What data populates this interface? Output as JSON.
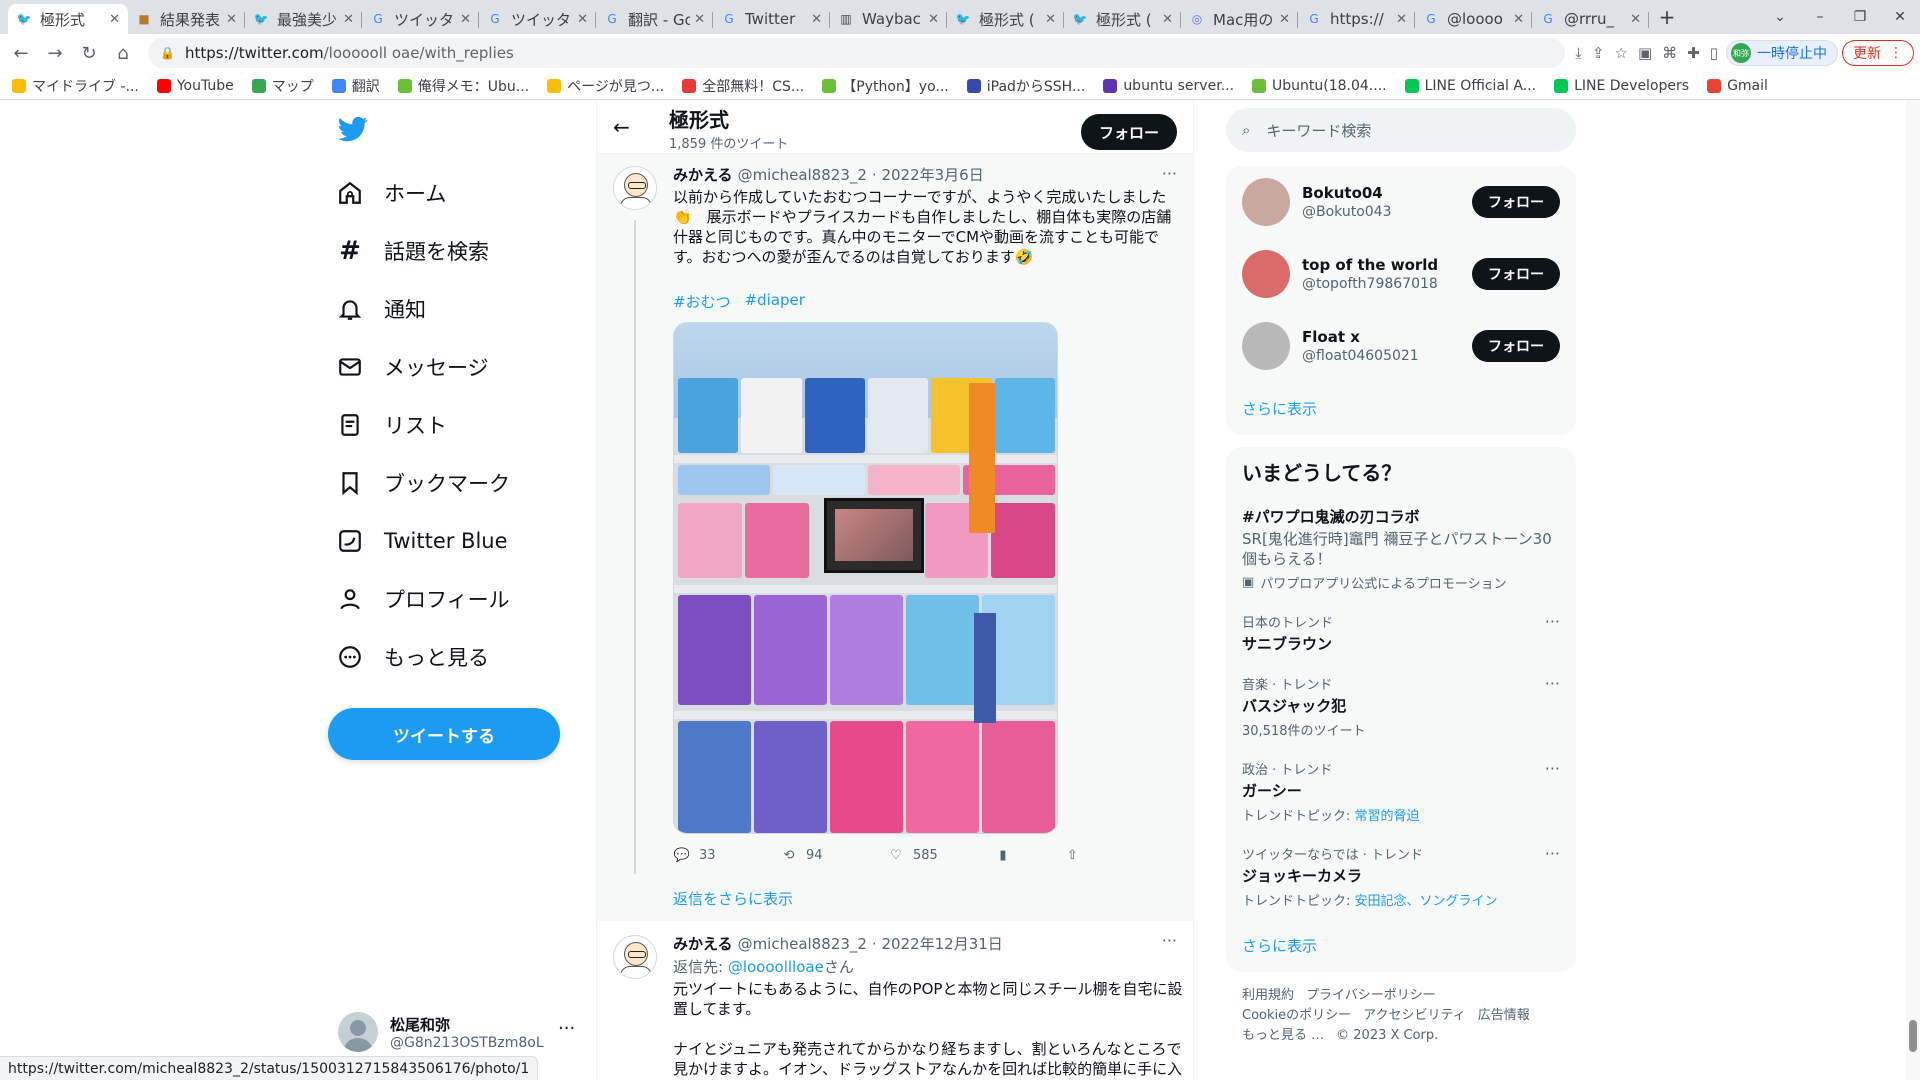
{
  "browser": {
    "tabs": [
      {
        "title": "極形式",
        "icon": "twitter-icon",
        "active": true
      },
      {
        "title": "結果発表",
        "icon": "site-icon"
      },
      {
        "title": "最強美少",
        "icon": "twitter-icon"
      },
      {
        "title": "ツイッタ",
        "icon": "google-icon"
      },
      {
        "title": "ツイッタ",
        "icon": "google-icon"
      },
      {
        "title": "翻訳 - Go",
        "icon": "google-icon"
      },
      {
        "title": "Twitter",
        "icon": "google-icon"
      },
      {
        "title": "Waybac",
        "icon": "archive-icon"
      },
      {
        "title": "極形式 (",
        "icon": "twitter-icon"
      },
      {
        "title": "極形式 (",
        "icon": "twitter-icon"
      },
      {
        "title": "Mac用の",
        "icon": "github-icon"
      },
      {
        "title": "https://",
        "icon": "google-icon"
      },
      {
        "title": "@loooo",
        "icon": "google-icon"
      },
      {
        "title": "@rrru_",
        "icon": "google-icon"
      }
    ],
    "url_host": "https://twitter.com",
    "url_path": "/loooooll oae/with_replies",
    "pause_label": "一時停止中",
    "profile_initials": "和弥",
    "update_label": "更新",
    "bookmarks": [
      {
        "label": "マイドライブ -...",
        "color": "#fbbc04"
      },
      {
        "label": "YouTube",
        "color": "#ff0000"
      },
      {
        "label": "マップ",
        "color": "#34a853"
      },
      {
        "label": "翻訳",
        "color": "#4285f4"
      },
      {
        "label": "俺得メモ：Ubu...",
        "color": "#6abf3b"
      },
      {
        "label": "ページが見つ...",
        "color": "#fbbc04"
      },
      {
        "label": "全部無料！CS...",
        "color": "#e53935"
      },
      {
        "label": "【Python】yo...",
        "color": "#6abf3b"
      },
      {
        "label": "iPadからSSH...",
        "color": "#3949ab"
      },
      {
        "label": "ubuntu server...",
        "color": "#5e35b1"
      },
      {
        "label": "Ubuntu(18.04....",
        "color": "#6abf3b"
      },
      {
        "label": "LINE Official A...",
        "color": "#06c755"
      },
      {
        "label": "LINE Developers",
        "color": "#06c755"
      },
      {
        "label": "Gmail",
        "color": "#ea4335"
      }
    ],
    "status_url": "https://twitter.com/micheal8823_2/status/1500312715843506176/photo/1"
  },
  "nav": {
    "items": [
      {
        "label": "ホーム",
        "icon": "home-icon"
      },
      {
        "label": "話題を検索",
        "icon": "hashtag-icon"
      },
      {
        "label": "通知",
        "icon": "bell-icon"
      },
      {
        "label": "メッセージ",
        "icon": "mail-icon"
      },
      {
        "label": "リスト",
        "icon": "list-icon"
      },
      {
        "label": "ブックマーク",
        "icon": "bookmark-icon"
      },
      {
        "label": "Twitter Blue",
        "icon": "twitter-blue-icon"
      },
      {
        "label": "プロフィール",
        "icon": "profile-icon"
      },
      {
        "label": "もっと見る",
        "icon": "more-icon"
      }
    ],
    "tweet_button": "ツイートする",
    "account_name": "松尾和弥",
    "account_handle": "@G8n213OSTBzm8oL"
  },
  "header": {
    "title": "極形式",
    "tweet_count": "1,859 件のツイート",
    "follow": "フォロー"
  },
  "tweet1": {
    "name": "みかえる",
    "handle": "@micheal8823_2",
    "date": "· 2022年3月6日",
    "text": "以前から作成していたおむつコーナーですが、ようやく完成いたしました👏　展示ボードやプライスカードも自作しましたし、棚自体も実際の店舗什器と同じものです。真ん中のモニターでCMや動画を流すことも可能です。おむつへの愛が歪んでるのは自覚しております🤣",
    "hashtags": [
      "#おむつ",
      "#diaper"
    ],
    "replies": "33",
    "retweets": "94",
    "likes": "585"
  },
  "more_replies": "返信をさらに表示",
  "tweet2": {
    "name": "みかえる",
    "handle": "@micheal8823_2",
    "date": "· 2022年12月31日",
    "reply_prefix": "返信先: ",
    "reply_to": "@loooollloae",
    "reply_suffix": "さん",
    "text1": "元ツイートにもあるように、自作のPOPと本物と同じスチール棚を自宅に設置してます。",
    "text2": "ナイとジュニアも発売されてからかなり経ちますし、割といろんなところで見かけますよ。イオン、ドラッグストアなんかを回れば比較的簡単に手に入ると思います。"
  },
  "right": {
    "search_placeholder": "キーワード検索",
    "who": [
      {
        "name": "Bokuto04",
        "handle": "@Bokuto043",
        "follow": "フォロー"
      },
      {
        "name": "top of the world",
        "handle": "@topofth79867018",
        "follow": "フォロー"
      },
      {
        "name": "Float x",
        "handle": "@float04605021",
        "follow": "フォロー"
      }
    ],
    "who_more": "さらに表示",
    "trend_title": "いまどうしてる？",
    "promo": {
      "name": "#パワプロ鬼滅の刃コラボ",
      "desc": "SR[鬼化進行時]竈門 禰豆子とパワストーン30個もらえる！",
      "by": "パワプロアプリ公式によるプロモーション"
    },
    "trends": [
      {
        "cat": "日本のトレンド",
        "name": "サニブラウン",
        "sub": "",
        "sub_link": ""
      },
      {
        "cat": "音楽 · トレンド",
        "name": "バスジャック犯",
        "sub": "30,518件のツイート",
        "sub_link": ""
      },
      {
        "cat": "政治 · トレンド",
        "name": "ガーシー",
        "sub": "トレンドトピック: ",
        "sub_link": "常習的脅迫"
      },
      {
        "cat": "ツイッターならでは · トレンド",
        "name": "ジョッキーカメラ",
        "sub": "トレンドトピック: ",
        "sub_link": "安田記念、ソングライン"
      }
    ],
    "trend_more": "さらに表示",
    "footer": [
      "利用規約",
      "プライバシーポリシー",
      "Cookieのポリシー",
      "アクセシビリティ",
      "広告情報",
      "もっと見る …",
      "© 2023 X Corp."
    ]
  }
}
